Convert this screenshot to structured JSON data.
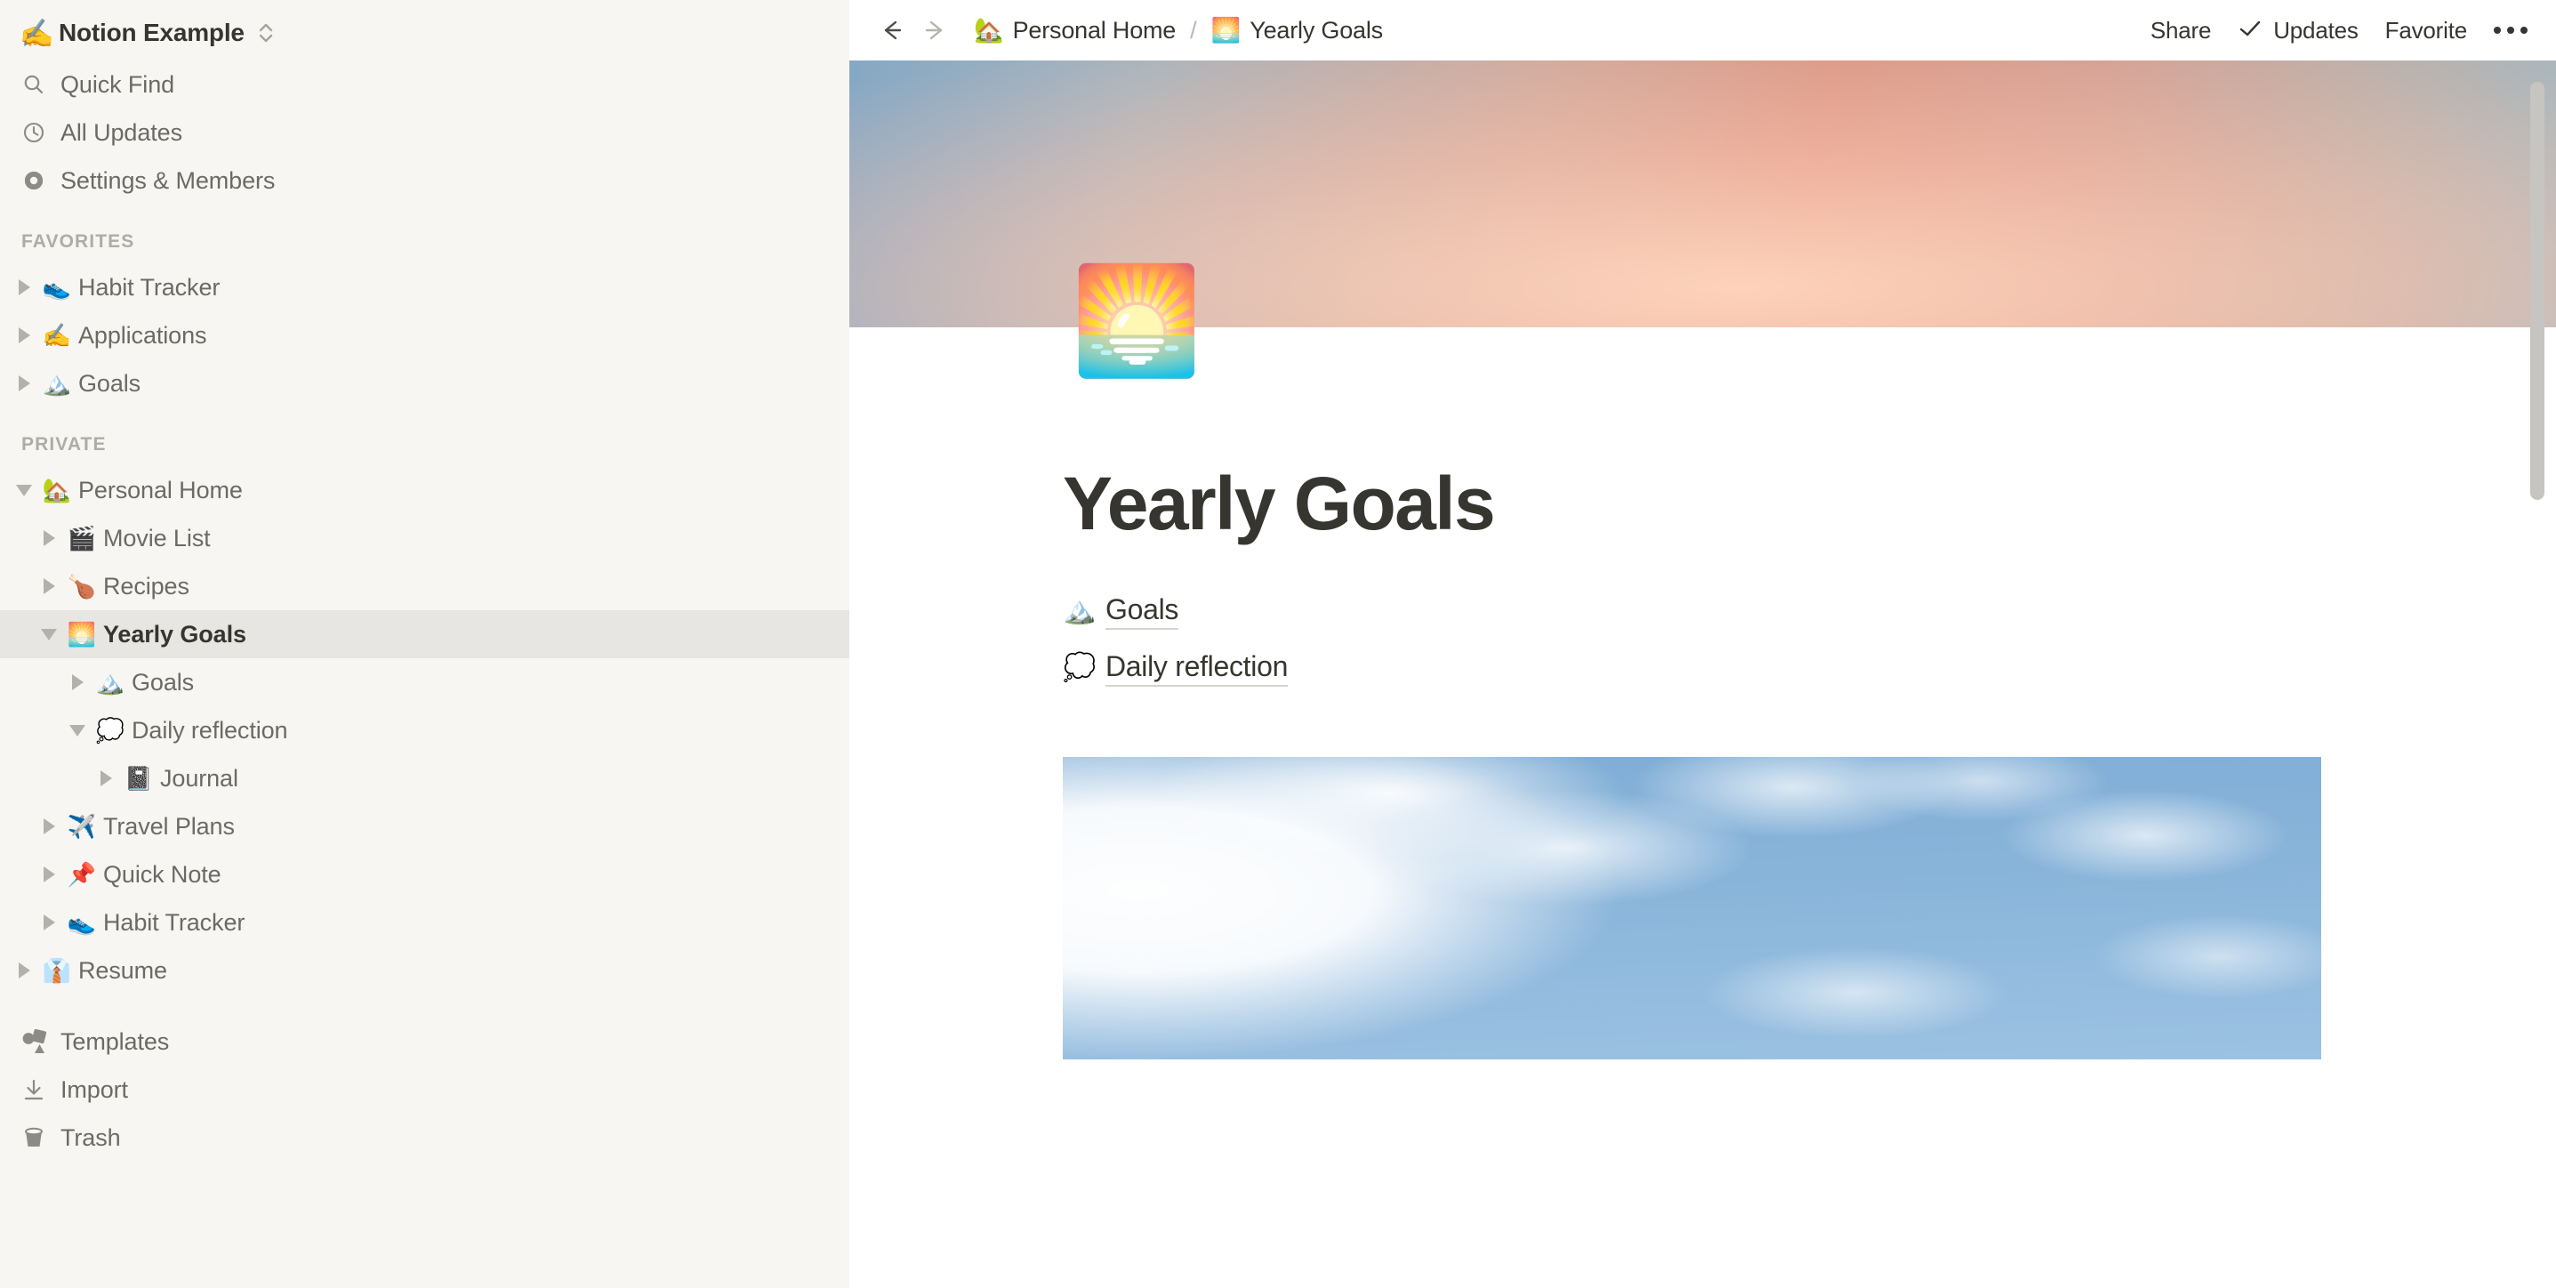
{
  "sidebar": {
    "workspace": {
      "emoji": "✍️",
      "name": "Notion Example",
      "switcher_icon": "chevron-updown-icon"
    },
    "nav": [
      {
        "icon": "search-icon",
        "label": "Quick Find"
      },
      {
        "icon": "clock-icon",
        "label": "All Updates"
      },
      {
        "icon": "gear-icon",
        "label": "Settings & Members"
      }
    ],
    "favorites_header": "FAVORITES",
    "favorites": [
      {
        "emoji": "👟",
        "label": "Habit Tracker",
        "expanded": false
      },
      {
        "emoji": "✍️",
        "label": "Applications",
        "expanded": false
      },
      {
        "emoji": "🏔️",
        "label": "Goals",
        "expanded": false
      }
    ],
    "private_header": "PRIVATE",
    "private": [
      {
        "emoji": "🏡",
        "label": "Personal Home",
        "depth": 0,
        "expanded": true,
        "selected": false
      },
      {
        "emoji": "🎬",
        "label": "Movie List",
        "depth": 1,
        "expanded": false,
        "selected": false
      },
      {
        "emoji": "🍗",
        "label": "Recipes",
        "depth": 1,
        "expanded": false,
        "selected": false
      },
      {
        "emoji": "🌅",
        "label": "Yearly Goals",
        "depth": 1,
        "expanded": true,
        "selected": true
      },
      {
        "emoji": "🏔️",
        "label": "Goals",
        "depth": 2,
        "expanded": false,
        "selected": false
      },
      {
        "emoji": "💭",
        "label": "Daily reflection",
        "depth": 2,
        "expanded": true,
        "selected": false
      },
      {
        "emoji": "📓",
        "label": "Journal",
        "depth": 3,
        "expanded": false,
        "selected": false
      },
      {
        "emoji": "✈️",
        "label": "Travel Plans",
        "depth": 1,
        "expanded": false,
        "selected": false
      },
      {
        "emoji": "📌",
        "label": "Quick Note",
        "depth": 1,
        "expanded": false,
        "selected": false
      },
      {
        "emoji": "👟",
        "label": "Habit Tracker",
        "depth": 1,
        "expanded": false,
        "selected": false
      },
      {
        "emoji": "👔",
        "label": "Resume",
        "depth": 0,
        "expanded": false,
        "selected": false
      }
    ],
    "bottom": [
      {
        "icon": "templates-icon",
        "label": "Templates"
      },
      {
        "icon": "import-icon",
        "label": "Import"
      },
      {
        "icon": "trash-icon",
        "label": "Trash"
      }
    ]
  },
  "topbar": {
    "back_icon": "arrow-left-icon",
    "forward_icon": "arrow-right-icon",
    "breadcrumb": [
      {
        "emoji": "🏡",
        "label": "Personal Home"
      },
      {
        "emoji": "🌅",
        "label": "Yearly Goals"
      }
    ],
    "separator": "/",
    "share_label": "Share",
    "updates_label": "Updates",
    "updates_icon": "check-icon",
    "favorite_label": "Favorite",
    "more_icon": "ellipsis-icon"
  },
  "page": {
    "cover_image": "sunset-gradient-cover",
    "icon_emoji": "🌅",
    "title": "Yearly Goals",
    "links": [
      {
        "emoji": "🏔️",
        "label": "Goals"
      },
      {
        "emoji": "💭",
        "label": "Daily reflection"
      }
    ],
    "image_block": "blue-sky-with-clouds"
  },
  "colors": {
    "sidebar_bg": "#f7f6f3",
    "selected_bg": "#e7e6e3",
    "text_primary": "#37352f",
    "text_secondary": "#6b6a65",
    "text_muted": "#aeaca6"
  }
}
